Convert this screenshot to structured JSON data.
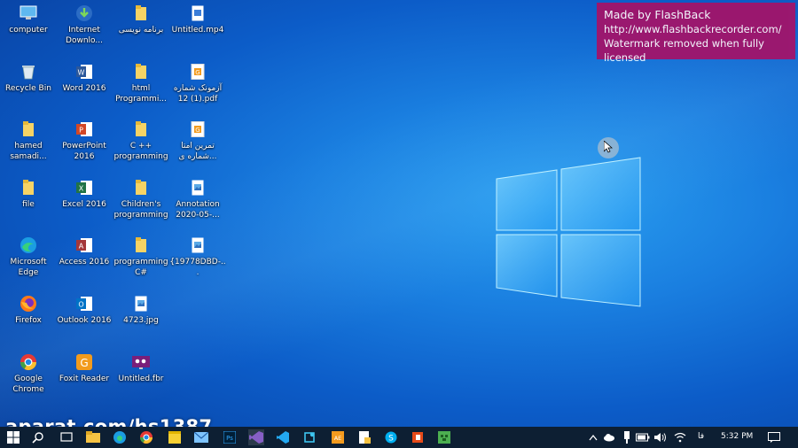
{
  "desktop": {
    "icons": [
      {
        "label": "computer",
        "kind": "computer-icon"
      },
      {
        "label": "Internet\nDownlo...",
        "kind": "idm-icon"
      },
      {
        "label": "برنامه نویسی",
        "kind": "folder-icon"
      },
      {
        "label": "Untitled.mp4",
        "kind": "video-file-icon"
      },
      {
        "label": "Recycle Bin",
        "kind": "recycle-bin-icon"
      },
      {
        "label": "Word 2016",
        "kind": "word-icon"
      },
      {
        "label": "html\nProgrammi...",
        "kind": "folder-icon"
      },
      {
        "label": "آزمونک شماره\n12 (1).pdf",
        "kind": "pdf-icon"
      },
      {
        "label": "hamed\nsamadi...",
        "kind": "folder-icon"
      },
      {
        "label": "PowerPoint\n2016",
        "kind": "powerpoint-icon"
      },
      {
        "label": "C ++\nprogramming",
        "kind": "folder-icon"
      },
      {
        "label": "تمرین امتا\nشماره ی...",
        "kind": "pdf-icon"
      },
      {
        "label": "file",
        "kind": "folder-icon"
      },
      {
        "label": "Excel 2016",
        "kind": "excel-icon"
      },
      {
        "label": "Children's\nprogramming",
        "kind": "folder-icon"
      },
      {
        "label": "Annotation\n2020-05-...",
        "kind": "image-file-icon"
      },
      {
        "label": "Microsoft\nEdge",
        "kind": "edge-icon"
      },
      {
        "label": "Access 2016",
        "kind": "access-icon"
      },
      {
        "label": "programming\nC#",
        "kind": "folder-icon"
      },
      {
        "label": "{19778DBD-...",
        "kind": "image-file-icon"
      },
      {
        "label": "Firefox",
        "kind": "firefox-icon"
      },
      {
        "label": "Outlook 2016",
        "kind": "outlook-icon"
      },
      {
        "label": "4723.jpg",
        "kind": "image-file-icon"
      },
      {
        "label": "Google\nChrome",
        "kind": "chrome-icon"
      },
      {
        "label": "Foxit Reader",
        "kind": "foxit-icon"
      },
      {
        "label": "Untitled.fbr",
        "kind": "fbr-file-icon"
      }
    ]
  },
  "watermark": {
    "line1": "Made by FlashBack",
    "line2": "http://www.flashbackrecorder.com/",
    "line3": "Watermark removed when fully licensed"
  },
  "overlay": {
    "text": "aparat.com/hs1387"
  },
  "taskbar": {
    "apps": [
      "start-icon",
      "search-icon",
      "file-explorer-icon",
      "edge-icon",
      "chrome-icon",
      "sticky-notes-icon",
      "mail-icon",
      "photoshop-icon",
      "visual-studio-icon",
      "vscode-icon",
      "app-icon",
      "ae-icon",
      "notepad-icon",
      "skype-icon",
      "office-icon",
      "minecraft-icon"
    ],
    "tray": {
      "lang": "فا",
      "time": "5:32 PM"
    }
  },
  "colors": {
    "taskbar": "#0d1f33",
    "watermark": "#a2146a",
    "accent": "#1a7fe0"
  }
}
